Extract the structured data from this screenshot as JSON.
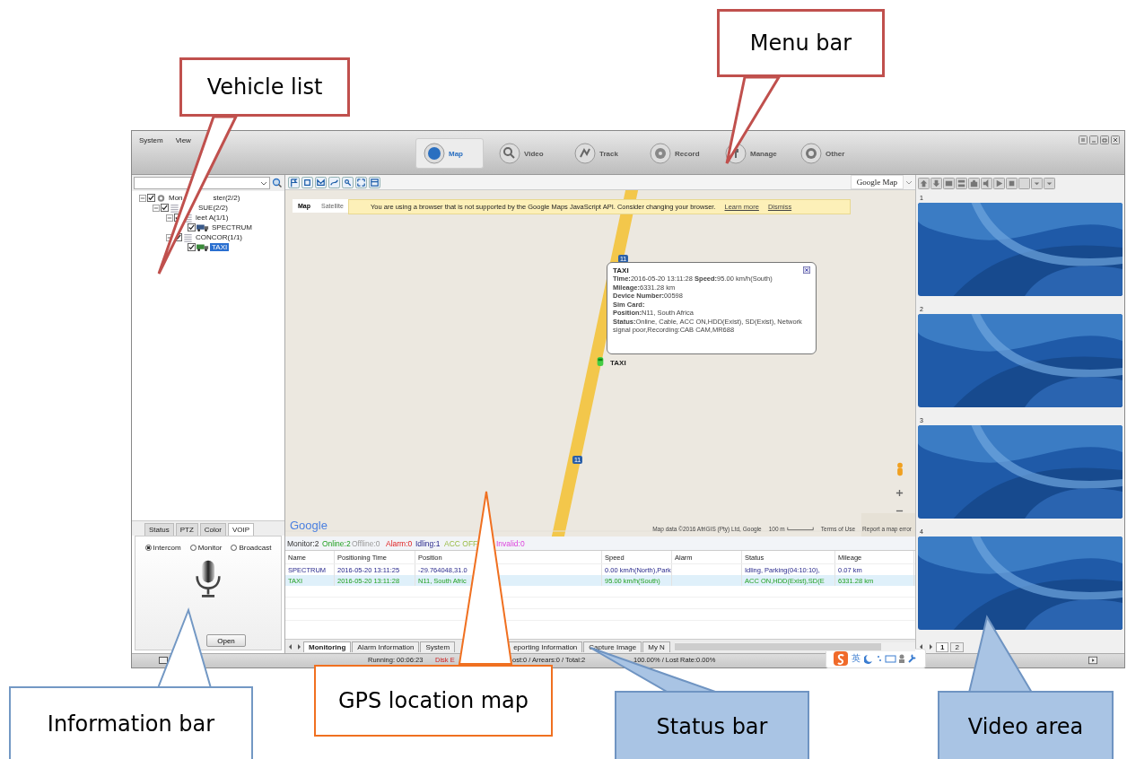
{
  "menu": [
    "System",
    "View"
  ],
  "nav": [
    {
      "label": "Map",
      "selected": true,
      "kind": "globe"
    },
    {
      "label": "Video",
      "selected": false,
      "kind": "search"
    },
    {
      "label": "Track",
      "selected": false,
      "kind": "track"
    },
    {
      "label": "Record",
      "selected": false,
      "kind": "record"
    },
    {
      "label": "Manage",
      "selected": false,
      "kind": "manage"
    },
    {
      "label": "Other",
      "selected": false,
      "kind": "other"
    }
  ],
  "tree": [
    {
      "prefix": "Mon",
      "label": "ster(2/2)",
      "kind": "center",
      "checked": true,
      "selected": false,
      "expanded": true,
      "children": [
        {
          "label": "SUE(2/2)",
          "kind": "group",
          "checked": true,
          "selected": false,
          "expanded": true,
          "children": [
            {
              "label": "leet A(1/1)",
              "kind": "group",
              "checked": true,
              "selected": false,
              "expanded": true,
              "children": [
                {
                  "label": "SPECTRUM",
                  "kind": "vehicle",
                  "checked": true,
                  "selected": false
                }
              ]
            },
            {
              "label": "CONCOR(1/1)",
              "kind": "group",
              "checked": true,
              "selected": false,
              "expanded": true,
              "children": [
                {
                  "label": "TAXI",
                  "kind": "vehicle",
                  "checked": true,
                  "selected": true
                }
              ]
            }
          ]
        }
      ]
    }
  ],
  "info_tabs": [
    {
      "label": "Status",
      "selected": false
    },
    {
      "label": "PTZ",
      "selected": false
    },
    {
      "label": "Color",
      "selected": false
    },
    {
      "label": "VOIP",
      "selected": true
    }
  ],
  "voip_modes": [
    {
      "label": "Intercom",
      "selected": true
    },
    {
      "label": "Monitor",
      "selected": false
    },
    {
      "label": "Broadcast",
      "selected": false
    }
  ],
  "voip_button": "Open",
  "map_type": "Google Map",
  "map": {
    "tabs": [
      {
        "label": "Map",
        "selected": true
      },
      {
        "label": "Satellite",
        "selected": false
      }
    ],
    "warning": "You are using a browser that is not supported by the Google Maps JavaScript API. Consider changing your browser.",
    "links": [
      "Learn more",
      "Dismiss"
    ],
    "road_signs": [
      "11",
      "11"
    ],
    "marker_label": "TAXI",
    "popup": {
      "title": "TAXI",
      "lines": [
        "**Time:**2016-05-20 13:11:28      **Speed:**95.00 km/h(South)",
        "**Mileage:**6331.28 km",
        "**Device Number:**00598",
        "**Sim Card:**",
        "**Position:**N11, South Africa",
        "**Status:**Online, Cable, ACC ON,HDD(Exist), SD(Exist), Network signal poor,Recording:CAB CAM,MR688"
      ]
    },
    "logo": "Google",
    "attribution": [
      "Map data ©2016 AfriGIS (Pty) Ltd, Google",
      "100 m",
      "Terms of Use",
      "Report a map error"
    ]
  },
  "counters": [
    {
      "label": "Monitor:2",
      "kind": "monitor"
    },
    {
      "label": "Online:2",
      "kind": "online"
    },
    {
      "label": "Offline:0",
      "kind": "offline"
    },
    {
      "label": "Alarm:0",
      "kind": "alarm"
    },
    {
      "label": "Idling:1",
      "kind": "idling"
    },
    {
      "label": "ACC OFF:",
      "kind": "acc_off"
    },
    {
      "label": "Invalid:0",
      "kind": "invalid"
    }
  ],
  "table": {
    "columns": [
      "Name",
      "Positioning Time",
      "Position",
      "Speed",
      "Alarm",
      "Status",
      "Mileage"
    ],
    "rows": [
      {
        "selected": false,
        "kind": "idling",
        "cells": [
          "SPECTRUM",
          "2016-05-20 13:11:25",
          "-29.764048,31.0",
          "0.00 km/h(North),Park",
          "",
          "Idling, Parking(04:10:10),",
          "0.07 km"
        ]
      },
      {
        "selected": true,
        "kind": "online",
        "cells": [
          "TAXI",
          "2016-05-20 13:11:28",
          "N11, South Afric",
          "95.00 km/h(South)",
          "",
          "ACC ON,HDD(Exist),SD(E",
          "6331.28 km"
        ]
      }
    ]
  },
  "bottom_tabs": [
    {
      "label": "Monitoring",
      "selected": true
    },
    {
      "label": "Alarm Information",
      "selected": false
    },
    {
      "label": "System",
      "selected": false
    },
    {
      "label": "eporting Information",
      "selected": false
    },
    {
      "label": "Capture Image",
      "selected": false
    },
    {
      "label": "My N",
      "selected": false
    }
  ],
  "video_cells": [
    "1",
    "2",
    "3",
    "4"
  ],
  "video_pages": [
    {
      "label": "1",
      "selected": true
    },
    {
      "label": "2",
      "selected": false
    }
  ],
  "status": [
    "Running: 00:06:23",
    "Disk E",
    "ost:0 / Arrears:0 / Total:2",
    "100.00% / Lost Rate:0.00%"
  ],
  "ime": "英",
  "callouts": [
    {
      "label": "Vehicle list",
      "kind": "red"
    },
    {
      "label": "Menu bar",
      "kind": "red"
    },
    {
      "label": "Information bar",
      "kind": "outline"
    },
    {
      "label": "GPS location map",
      "kind": "orange"
    },
    {
      "label": "Status bar",
      "kind": "filled"
    },
    {
      "label": "Video area",
      "kind": "filled"
    }
  ]
}
